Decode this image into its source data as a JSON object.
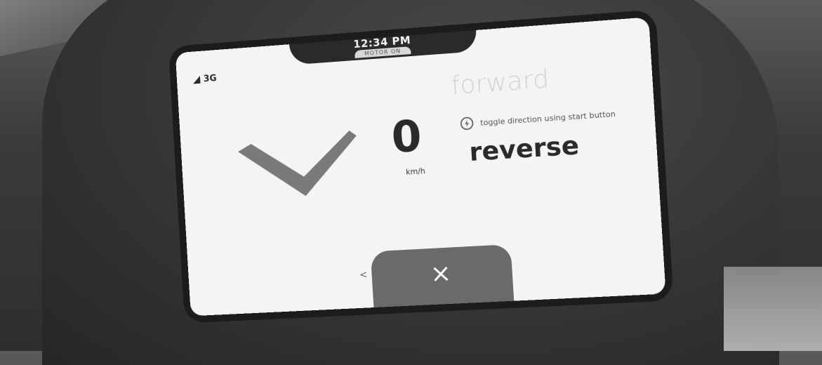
{
  "status": {
    "time": "12:34 PM",
    "motor_status": "MOTOR ON",
    "network": "3G"
  },
  "dashboard": {
    "speed": "0",
    "speed_unit": "km/h",
    "direction_inactive": "forward",
    "direction_hint": "toggle direction using start button",
    "direction_active": "reverse"
  },
  "navigation": {
    "back_glyph": "<",
    "close_icon": "close-icon"
  },
  "colors": {
    "screen": "#f3f5f5",
    "chevron": "#7a7a7a",
    "close_tab": "#6a6a6a"
  }
}
